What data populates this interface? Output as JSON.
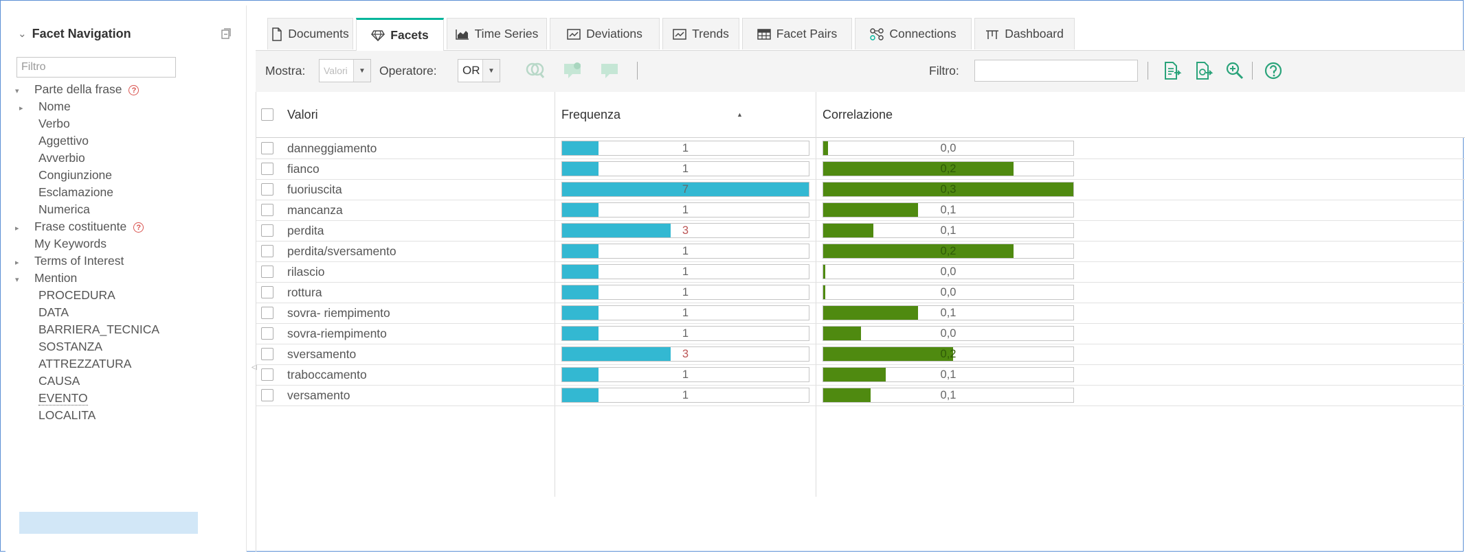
{
  "left_panel": {
    "title": "Facet Navigation",
    "filter_placeholder": "Filtro",
    "tree": [
      {
        "label": "Parte della frase",
        "expander": "▾",
        "level": 0,
        "help": true
      },
      {
        "label": "Nome",
        "expander": "▸",
        "level": 1
      },
      {
        "label": "Verbo",
        "level": 1
      },
      {
        "label": "Aggettivo",
        "level": 1
      },
      {
        "label": "Avverbio",
        "level": 1
      },
      {
        "label": "Congiunzione",
        "level": 1
      },
      {
        "label": "Esclamazione",
        "level": 1
      },
      {
        "label": "Numerica",
        "level": 1
      },
      {
        "label": "Frase costituente",
        "expander": "▸",
        "level": 0,
        "help": true
      },
      {
        "label": "My Keywords",
        "level": 0
      },
      {
        "label": "Terms of Interest",
        "expander": "▸",
        "level": 0
      },
      {
        "label": "Mention",
        "expander": "▾",
        "level": 0
      },
      {
        "label": "PROCEDURA",
        "level": 1
      },
      {
        "label": "DATA",
        "level": 1
      },
      {
        "label": "BARRIERA_TECNICA",
        "level": 1
      },
      {
        "label": "SOSTANZA",
        "level": 1
      },
      {
        "label": "ATTREZZATURA",
        "level": 1
      },
      {
        "label": "CAUSA",
        "level": 1
      },
      {
        "label": "EVENTO",
        "level": 1,
        "selected": true
      },
      {
        "label": "LOCALITA",
        "level": 1
      }
    ]
  },
  "tabs": [
    {
      "label": "Documents",
      "icon": "document-icon"
    },
    {
      "label": "Facets",
      "icon": "gem-icon",
      "active": true
    },
    {
      "label": "Time Series",
      "icon": "area-chart-icon"
    },
    {
      "label": "Deviations",
      "icon": "deviation-chart-icon"
    },
    {
      "label": "Trends",
      "icon": "trend-chart-icon"
    },
    {
      "label": "Facet Pairs",
      "icon": "grid-icon"
    },
    {
      "label": "Connections",
      "icon": "connections-icon"
    },
    {
      "label": "Dashboard",
      "icon": "dashboard-icon"
    }
  ],
  "toolbar": {
    "show_label": "Mostra:",
    "show_value": "Valori",
    "operator_label": "Operatore:",
    "operator_value": "OR",
    "filter_label": "Filtro:",
    "filter_value": ""
  },
  "table": {
    "columns": {
      "values": "Valori",
      "frequency": "Frequenza",
      "correlation": "Correlazione"
    },
    "colors": {
      "frequency": "#33b8d2",
      "correlation": "#4f8a10"
    },
    "max_frequency": 7,
    "rows": [
      {
        "name": "danneggiamento",
        "freq": 1,
        "freq_label": "1",
        "corr": 0.02,
        "corr_label": "0,0"
      },
      {
        "name": "fianco",
        "freq": 1,
        "freq_label": "1",
        "corr": 0.76,
        "corr_label": "0,2"
      },
      {
        "name": "fuoriuscita",
        "freq": 7,
        "freq_label": "7",
        "corr": 1.0,
        "corr_label": "0,3"
      },
      {
        "name": "mancanza",
        "freq": 1,
        "freq_label": "1",
        "corr": 0.38,
        "corr_label": "0,1"
      },
      {
        "name": "perdita",
        "freq": 3,
        "freq_label": "3",
        "corr": 0.2,
        "corr_label": "0,1"
      },
      {
        "name": "perdita/sversamento",
        "freq": 1,
        "freq_label": "1",
        "corr": 0.76,
        "corr_label": "0,2"
      },
      {
        "name": "rilascio",
        "freq": 1,
        "freq_label": "1",
        "corr": 0.0,
        "corr_label": "0,0"
      },
      {
        "name": "rottura",
        "freq": 1,
        "freq_label": "1",
        "corr": 0.0,
        "corr_label": "0,0"
      },
      {
        "name": "sovra- riempimento",
        "freq": 1,
        "freq_label": "1",
        "corr": 0.38,
        "corr_label": "0,1"
      },
      {
        "name": "sovra-riempimento",
        "freq": 1,
        "freq_label": "1",
        "corr": 0.15,
        "corr_label": "0,0"
      },
      {
        "name": "sversamento",
        "freq": 3,
        "freq_label": "3",
        "corr": 0.52,
        "corr_label": "0,2"
      },
      {
        "name": "traboccamento",
        "freq": 1,
        "freq_label": "1",
        "corr": 0.25,
        "corr_label": "0,1"
      },
      {
        "name": "versamento",
        "freq": 1,
        "freq_label": "1",
        "corr": 0.19,
        "corr_label": "0,1"
      }
    ]
  }
}
